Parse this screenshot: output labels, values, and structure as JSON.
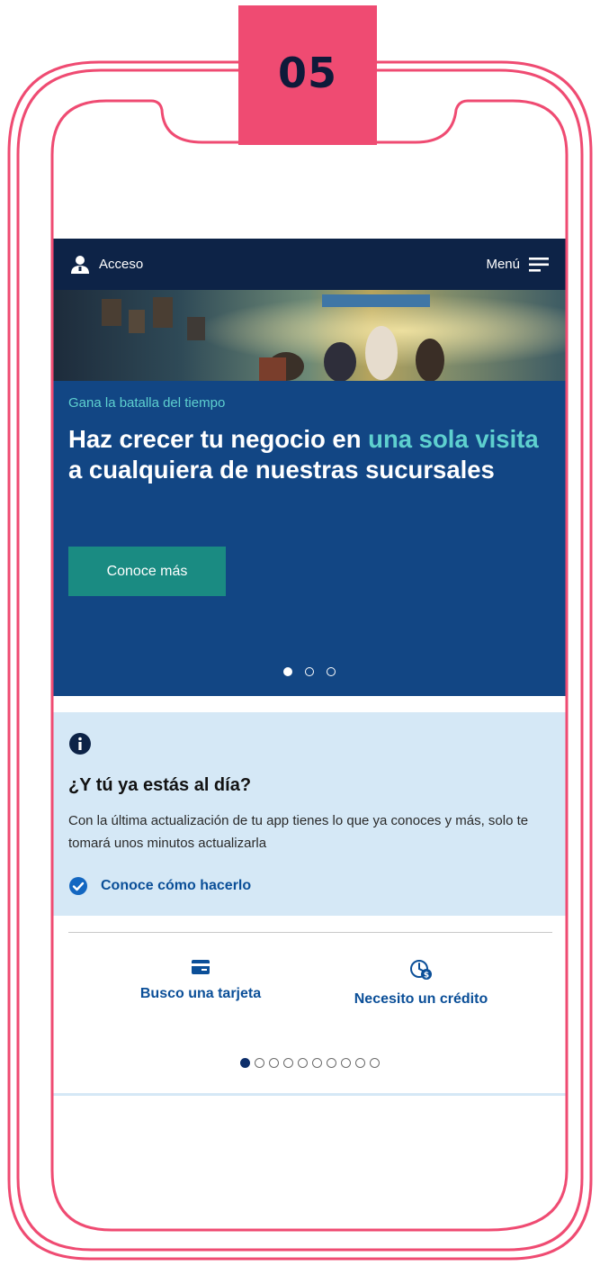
{
  "badge": {
    "number": "05"
  },
  "topbar": {
    "access_label": "Acceso",
    "menu_label": "Menú"
  },
  "hero": {
    "kicker": "Gana la batalla del tiempo",
    "headline_part1": "Haz crecer tu negocio en ",
    "headline_highlight": "una sola visita",
    "headline_part2": " a cualquiera de nuestras sucursales",
    "cta_label": "Conoce más",
    "carousel_dots": 3,
    "carousel_active": 1
  },
  "info_card": {
    "icon": "info-icon",
    "title": "¿Y tú ya estás al día?",
    "body": "Con la última actualización de tu app tienes lo que ya conoces y más, solo te tomará unos minutos actualizarla",
    "link_label": "Conoce cómo hacerlo"
  },
  "shortcuts": [
    {
      "icon": "card-icon",
      "label": "Busco una tarjeta"
    },
    {
      "icon": "credit-clock-icon",
      "label": "Necesito un crédito"
    }
  ],
  "shortcut_pager": {
    "total": 10,
    "active": 1
  },
  "colors": {
    "frame": "#ef4b72",
    "navy": "#0d2347",
    "hero_blue": "#124684",
    "accent_teal": "#5ed0cf",
    "cta_green": "#1a8b82",
    "link_blue": "#0b4f98",
    "info_bg": "#d5e8f6"
  }
}
